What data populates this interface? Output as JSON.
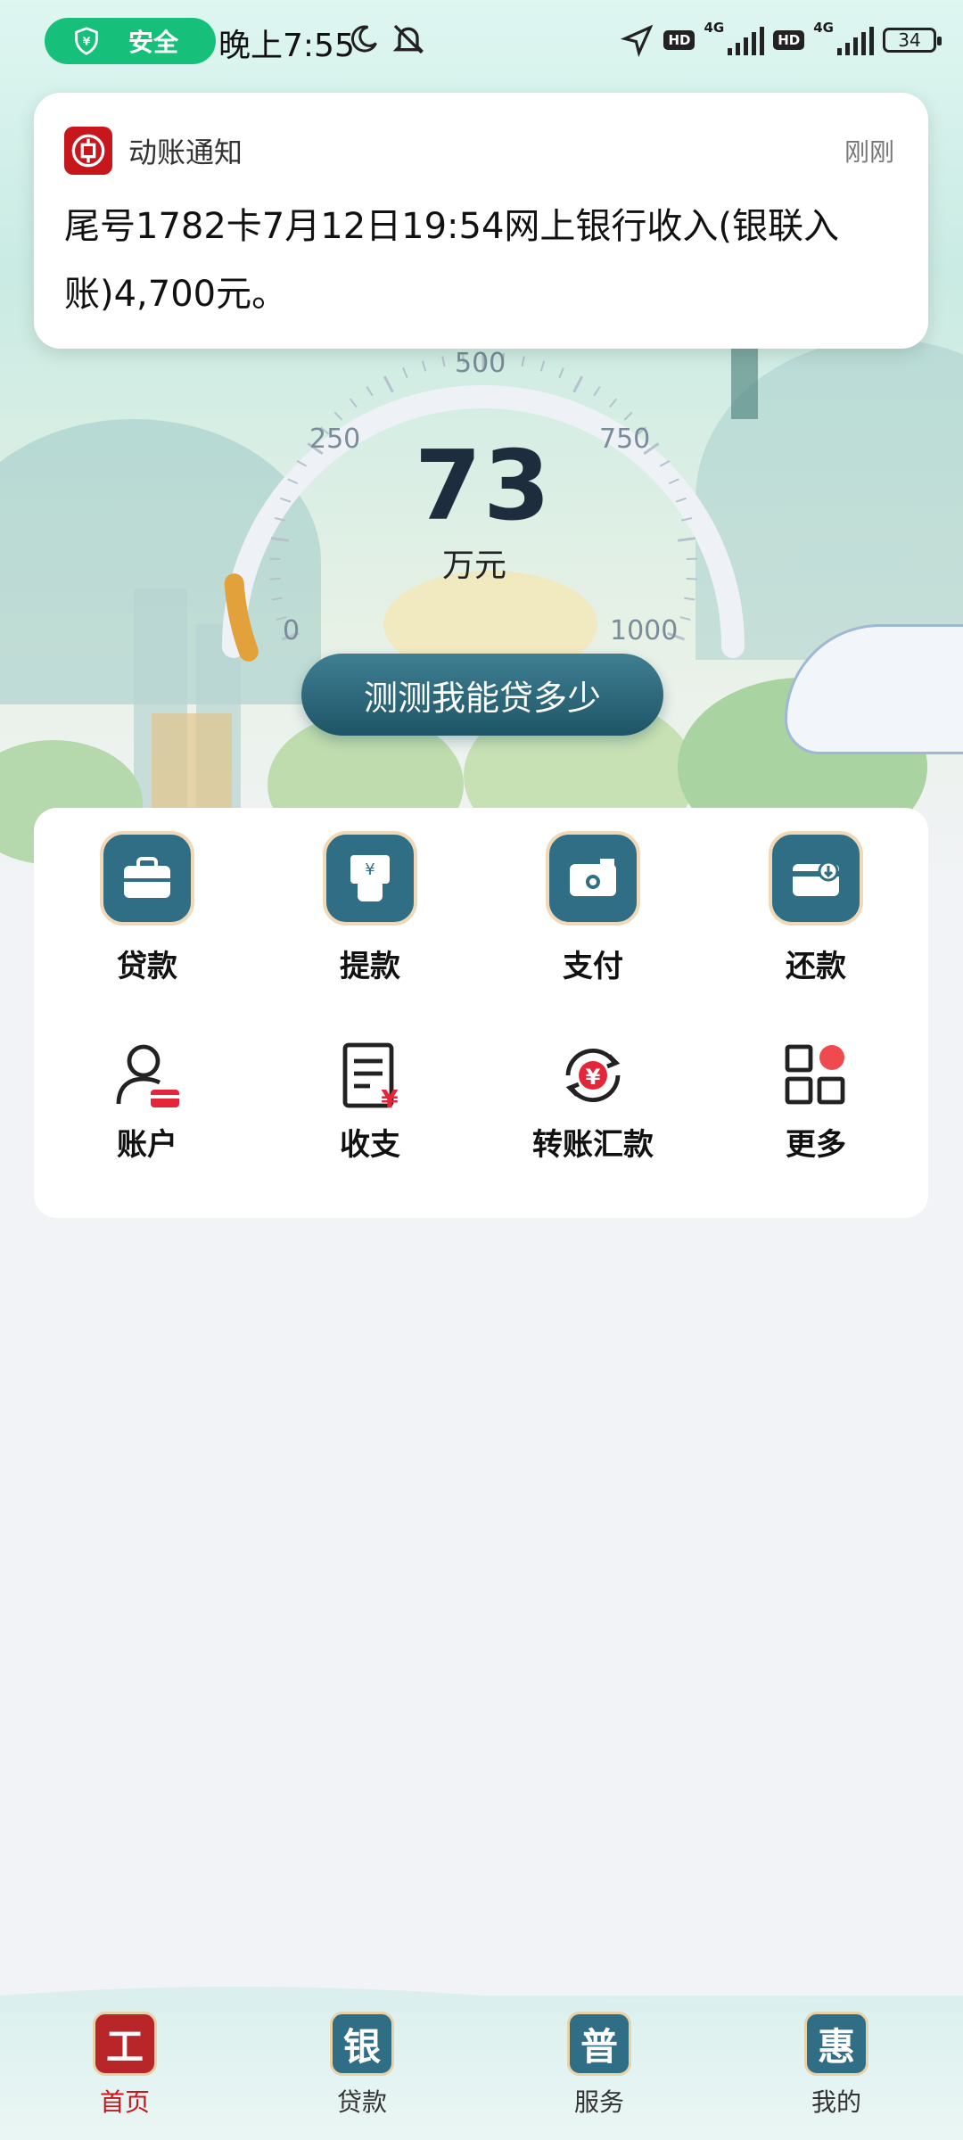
{
  "status_bar": {
    "safe_label": "安全",
    "time": "晚上7:55",
    "hd1": "HD",
    "net1": "4G",
    "hd2": "HD",
    "net2": "4G",
    "battery": "34"
  },
  "notification": {
    "app_name": "动账通知",
    "time": "刚刚",
    "body": "尾号1782卡7月12日19:54网上银行收入(银联入账)4,700元。"
  },
  "gauge": {
    "value": "73",
    "unit": "万元",
    "ticks": [
      "0",
      "250",
      "500",
      "750",
      "1000"
    ],
    "fill_fraction": 0.073
  },
  "cta_label": "测测我能贷多少",
  "grid": [
    {
      "label": "贷款",
      "icon": "briefcase-icon"
    },
    {
      "label": "提款",
      "icon": "withdraw-icon"
    },
    {
      "label": "支付",
      "icon": "wallet-icon"
    },
    {
      "label": "还款",
      "icon": "card-repay-icon"
    },
    {
      "label": "账户",
      "icon": "user-card-icon"
    },
    {
      "label": "收支",
      "icon": "ledger-icon"
    },
    {
      "label": "转账汇款",
      "icon": "transfer-icon"
    },
    {
      "label": "更多",
      "icon": "grid-more-icon"
    }
  ],
  "nav": [
    {
      "label": "首页",
      "seal": "工",
      "color": "#b9262a"
    },
    {
      "label": "贷款",
      "seal": "银",
      "color": "#2f6e85"
    },
    {
      "label": "服务",
      "seal": "普",
      "color": "#2f6e85"
    },
    {
      "label": "我的",
      "seal": "惠",
      "color": "#2f6e85"
    }
  ]
}
